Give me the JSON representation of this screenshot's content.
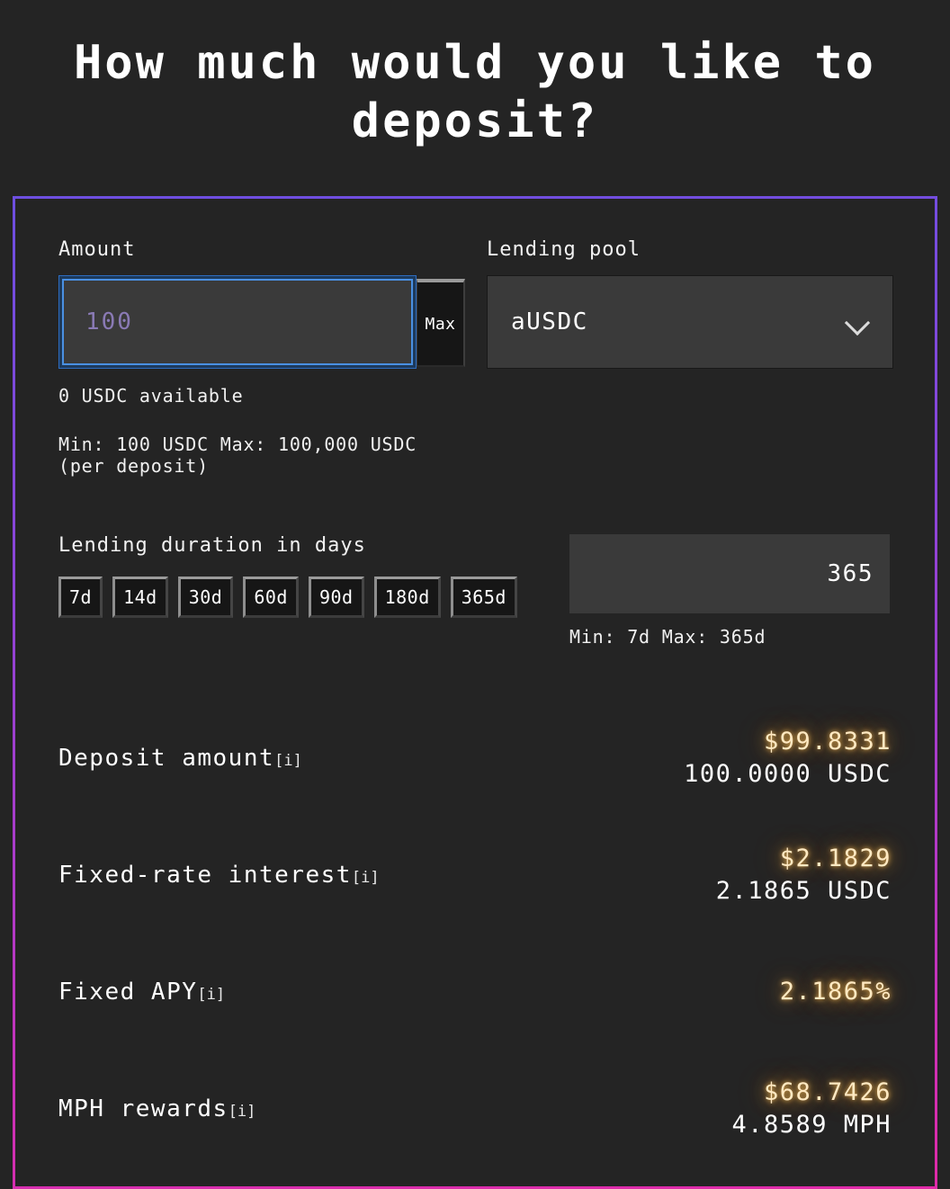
{
  "page": {
    "title": "How much would you like to\ndeposit?",
    "accent_border_top": "#6d4fe0",
    "accent_border_bottom": "#e02aa8",
    "background": "#242424",
    "glow_color": "#ffe9c2"
  },
  "amount": {
    "label": "Amount",
    "placeholder": "100",
    "value": "",
    "max_button": "Max",
    "available": "0 USDC available",
    "limits": "Min: 100 USDC Max: 100,000 USDC (per deposit)"
  },
  "pool": {
    "label": "Lending pool",
    "selected": "aUSDC",
    "chevron": "chevron-down-icon"
  },
  "duration": {
    "label": "Lending duration in days",
    "presets": [
      "7d",
      "14d",
      "30d",
      "60d",
      "90d",
      "180d",
      "365d"
    ],
    "value": "365",
    "limits": "Min: 7d Max: 365d"
  },
  "results": [
    {
      "label": "Deposit amount",
      "info": "[i]",
      "primary": "$99.8331",
      "secondary": "100.0000 USDC"
    },
    {
      "label": "Fixed-rate interest",
      "info": "[i]",
      "primary": "$2.1829",
      "secondary": "2.1865 USDC"
    },
    {
      "label": "Fixed APY",
      "info": "[i]",
      "primary": "2.1865%",
      "secondary": ""
    },
    {
      "label": "MPH rewards",
      "info": "[i]",
      "primary": "$68.7426",
      "secondary": "4.8589 MPH"
    }
  ]
}
